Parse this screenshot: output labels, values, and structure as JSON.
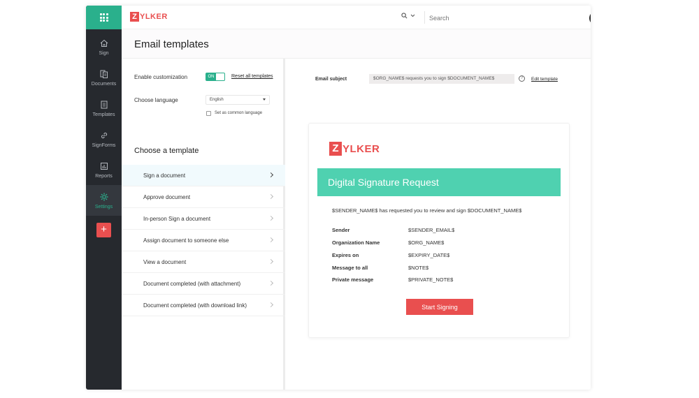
{
  "app": {
    "logo_first": "Z",
    "logo_rest": "YLKER"
  },
  "nav": {
    "items": [
      {
        "label": "Sign",
        "icon": "home-icon"
      },
      {
        "label": "Documents",
        "icon": "documents-icon"
      },
      {
        "label": "Templates",
        "icon": "templates-icon"
      },
      {
        "label": "SignForms",
        "icon": "link-icon"
      },
      {
        "label": "Reports",
        "icon": "reports-icon"
      },
      {
        "label": "Settings",
        "icon": "gear-icon",
        "active": true
      }
    ],
    "add_label": "+"
  },
  "topbar": {
    "search_placeholder": "Search"
  },
  "page": {
    "title": "Email templates"
  },
  "settings": {
    "enable_label": "Enable customization",
    "toggle_state": "ON",
    "reset_label": "Reset all templates",
    "language_label": "Choose language",
    "language_value": "English",
    "common_language_label": "Set as common language",
    "choose_template_label": "Choose a template",
    "templates": [
      "Sign a document",
      "Approve document",
      "In-person Sign a document",
      "Assign document to someone else",
      "View a document",
      "Document completed (with attachment)",
      "Document completed (with download link)"
    ],
    "active_template_index": 0
  },
  "preview": {
    "subject_label": "Email subject",
    "subject_value": "$ORG_NAME$ requests you to sign $DOCUMENT_NAME$",
    "help_label": "?",
    "edit_label": "Edit template",
    "banner_title": "Digital Signature Request",
    "intro": "$SENDER_NAME$ has requested you to review and sign $DOCUMENT_NAME$",
    "fields": [
      {
        "key": "Sender",
        "value": "$SENDER_EMAIL$"
      },
      {
        "key": "Organization Name",
        "value": "$ORG_NAME$"
      },
      {
        "key": "Expires on",
        "value": "$EXPIRY_DATE$"
      },
      {
        "key": "Message to all",
        "value": "$NOTE$"
      },
      {
        "key": "Private message",
        "value": "$PRIVATE_NOTE$"
      }
    ],
    "button_label": "Start Signing"
  },
  "colors": {
    "brand_red": "#e94f4f",
    "accent_green": "#2ab08c",
    "banner_green": "#4fd1b0",
    "rail_dark": "#26292e"
  }
}
